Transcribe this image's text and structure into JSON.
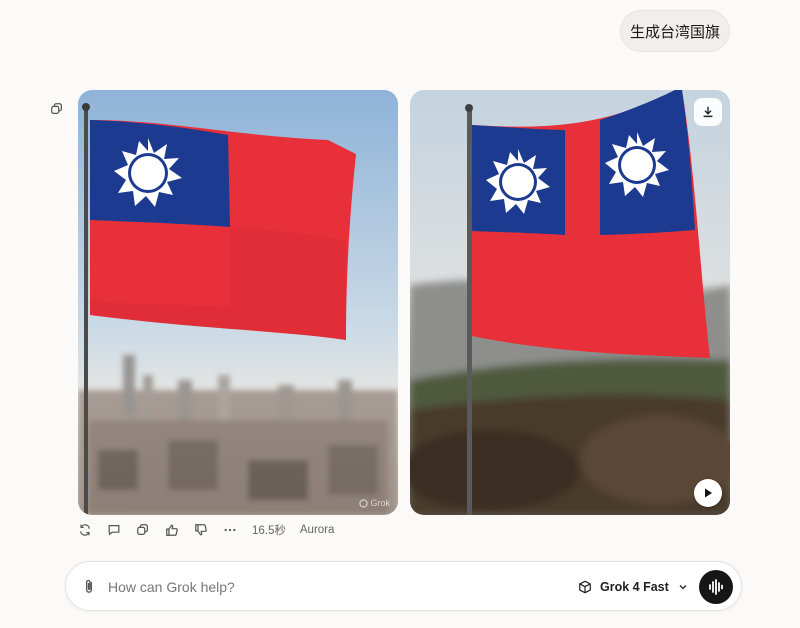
{
  "conversation": {
    "user_message": "生成台湾国旗"
  },
  "images": [
    {
      "scene": "flag-over-city",
      "watermark": "Grok"
    },
    {
      "scene": "flag-on-hillside"
    }
  ],
  "response_meta": {
    "duration": "16.5秒",
    "model_tag": "Aurora"
  },
  "composer": {
    "placeholder": "How can Grok help?",
    "model_label": "Grok 4 Fast"
  },
  "colors": {
    "flag_red": "#e8303a",
    "flag_blue": "#1c3a8f",
    "voice_button": "#161616"
  }
}
